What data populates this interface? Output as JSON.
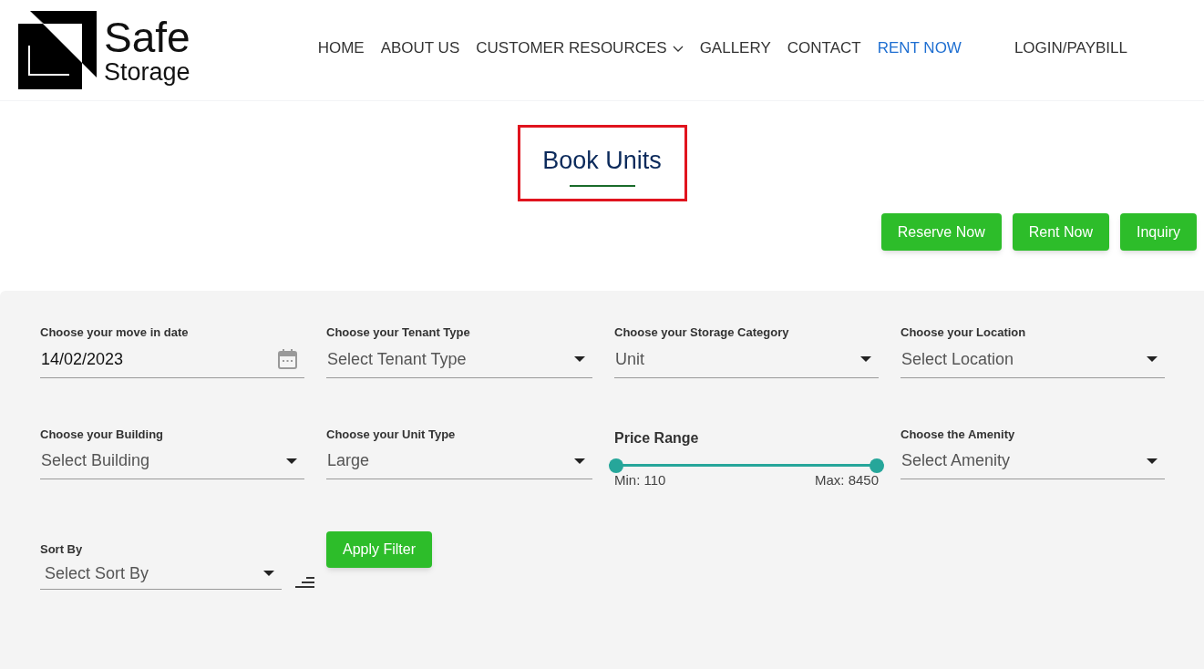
{
  "logo": {
    "line_1": "Safe",
    "line_2": "Storage"
  },
  "nav": [
    {
      "label": "HOME",
      "selected": false,
      "has_menu": false
    },
    {
      "label": "ABOUT US",
      "selected": false,
      "has_menu": false
    },
    {
      "label": "CUSTOMER RESOURCES",
      "selected": false,
      "has_menu": true
    },
    {
      "label": "GALLERY",
      "selected": false,
      "has_menu": false
    },
    {
      "label": "CONTACT",
      "selected": false,
      "has_menu": false
    },
    {
      "label": "RENT NOW",
      "selected": true,
      "has_menu": false
    },
    {
      "label": "LOGIN/PAYBILL",
      "selected": false,
      "has_menu": false
    }
  ],
  "heading": "Book Units",
  "actions": [
    "Reserve Now",
    "Rent Now",
    "Inquiry"
  ],
  "filters": [
    {
      "kind": "date",
      "label": "Choose your move in date",
      "value": "14/02/2023"
    },
    {
      "kind": "select",
      "label": "Choose your Tenant Type",
      "placeholder": "Select Tenant Type"
    },
    {
      "kind": "select",
      "label": "Choose your Storage Category",
      "value": "Unit"
    },
    {
      "kind": "select",
      "label": "Choose your Location",
      "placeholder": "Select Location"
    },
    {
      "kind": "select",
      "label": "Choose your Building",
      "placeholder": "Select Building"
    },
    {
      "kind": "select",
      "label": "Choose your Unit Type",
      "value": "Large"
    },
    {
      "kind": "range",
      "label": "Price Range",
      "thumbs": [
        {
          "level": 0
        },
        {
          "level": 1
        }
      ],
      "min": "Min: 110",
      "max": "Max: 8450"
    },
    {
      "kind": "select",
      "label": "Choose the Amenity",
      "placeholder": "Select Amenity"
    }
  ],
  "sort": {
    "label": "Sort By",
    "placeholder": "Select Sort By"
  },
  "apply_button": "Apply Filter"
}
